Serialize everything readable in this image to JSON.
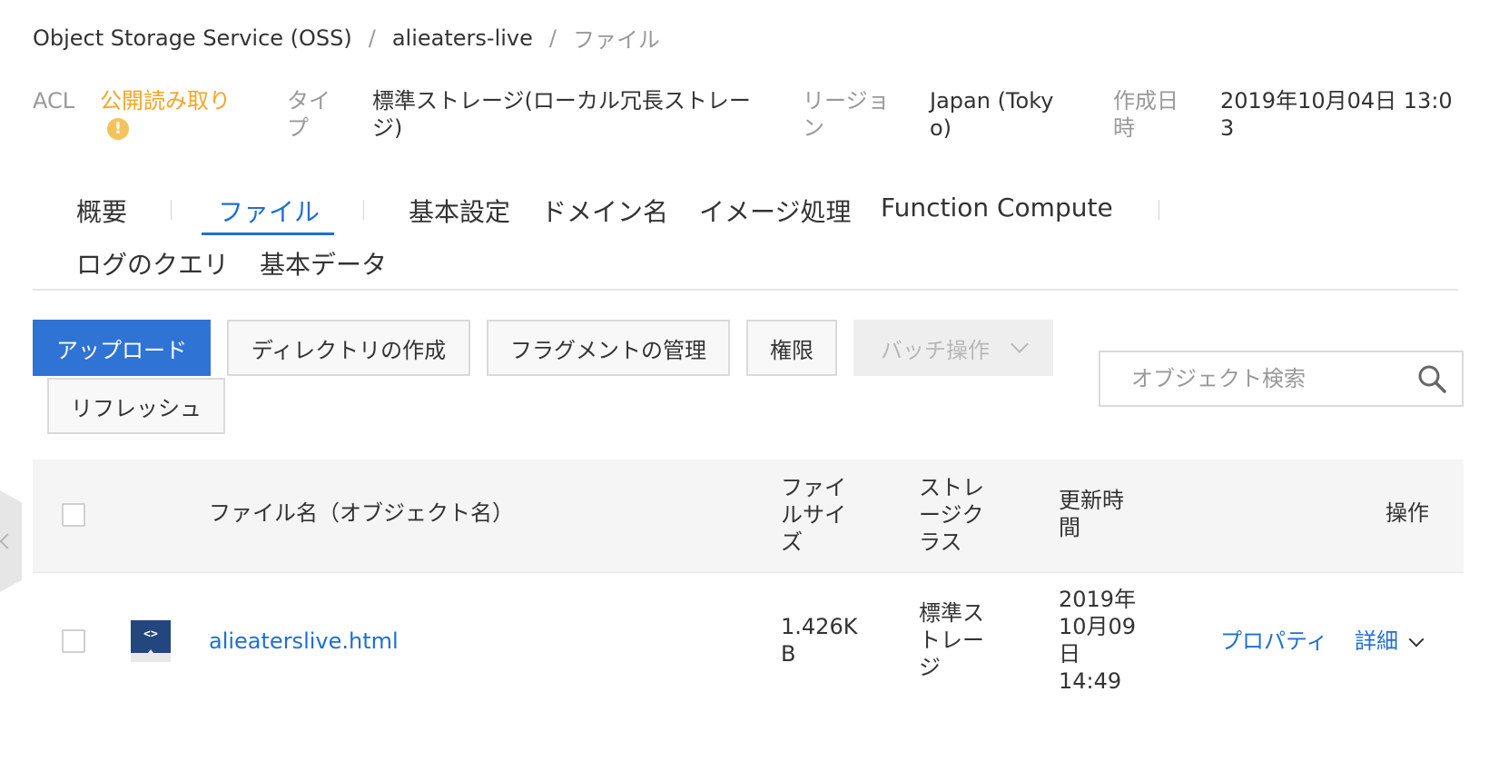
{
  "breadcrumb": {
    "items": [
      "Object Storage Service (OSS)",
      "alieaters-live",
      "ファイル"
    ],
    "separator": "/"
  },
  "info": {
    "acl_label": "ACL",
    "acl_value": "公開読み取り",
    "type_label_line1": "タイ",
    "type_label_line2": "プ",
    "type_value_line1": "標準ストレージ(ローカル冗長ストレー",
    "type_value_line2": "ジ)",
    "region_label_line1": "リージョ",
    "region_label_line2": "ン",
    "region_value_line1": "Japan (Toky",
    "region_value_line2": "o)",
    "created_label_line1": "作成日",
    "created_label_line2": "時",
    "created_value_line1": "2019年10月04日 13:0",
    "created_value_line2": "3",
    "warning_symbol": "!"
  },
  "tabs": [
    {
      "label": "概要"
    },
    {
      "label": "ファイル",
      "active": true
    },
    {
      "label": "基本設定"
    },
    {
      "label": "ドメイン名"
    },
    {
      "label": "イメージ処理"
    },
    {
      "label": "Function Compute"
    },
    {
      "label": "ログのクエリ"
    },
    {
      "label": "基本データ"
    }
  ],
  "toolbar": {
    "upload": "アップロード",
    "create_directory": "ディレクトリの作成",
    "manage_fragments": "フラグメントの管理",
    "permissions": "権限",
    "batch": "バッチ操作",
    "refresh": "リフレッシュ"
  },
  "search": {
    "placeholder": "オブジェクト検索",
    "value": ""
  },
  "table": {
    "headers": {
      "name": "ファイル名（オブジェクト名）",
      "size_line1": "ファイ",
      "size_line2": "ルサイ",
      "size_line3": "ズ",
      "class_line1": "ストレ",
      "class_line2": "ージク",
      "class_line3": "ラス",
      "updated_line1": "更新時",
      "updated_line2": "間",
      "actions": "操作"
    },
    "rows": [
      {
        "icon": "html-file-icon",
        "icon_glyph": "<>",
        "name": "alieaterslive.html",
        "size_line1": "1.426K",
        "size_line2": "B",
        "class_line1": "標準ス",
        "class_line2": "トレー",
        "class_line3": "ジ",
        "updated_line1": "2019年",
        "updated_line2": "10月09",
        "updated_line3": "日",
        "updated_line4": "14:49",
        "action_properties": "プロパティ",
        "action_details": "詳細"
      }
    ]
  },
  "colors": {
    "accent": "#1f6fd1",
    "primary_button": "#2f73d5",
    "acl_warning": "#f5a623",
    "file_icon": "#24467f"
  }
}
